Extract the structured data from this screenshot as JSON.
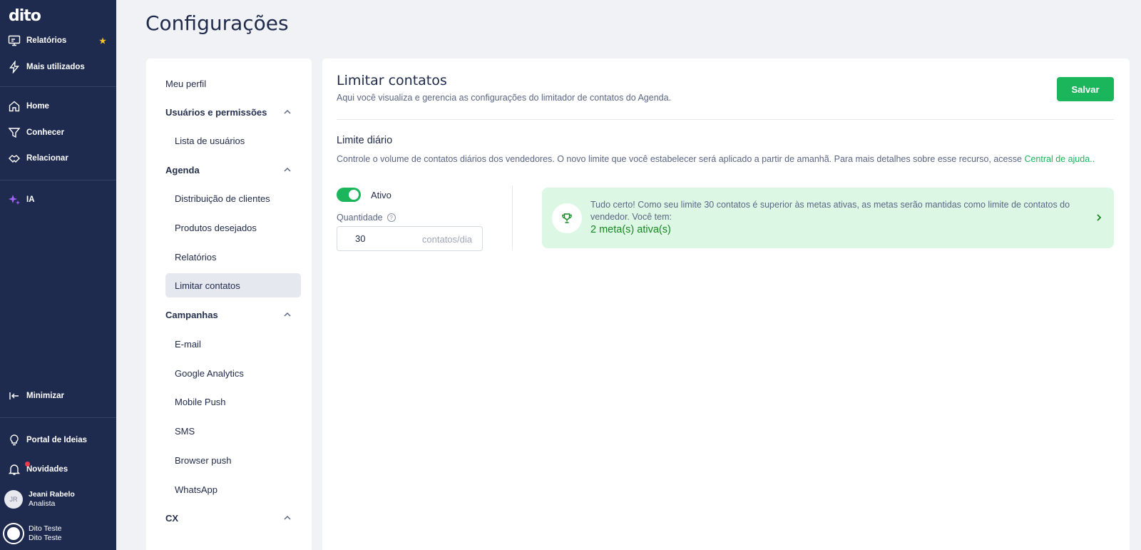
{
  "nav": {
    "logo": "dito",
    "items": [
      {
        "label": "Relatórios"
      },
      {
        "label": "Mais utilizados"
      },
      {
        "label": "Home"
      },
      {
        "label": "Conhecer"
      },
      {
        "label": "Relacionar"
      },
      {
        "label": "IA"
      },
      {
        "label": "Minimizar"
      },
      {
        "label": "Portal de Ideias"
      },
      {
        "label": "Novidades"
      }
    ],
    "user": {
      "initials": "JR",
      "name": "Jeani Rabelo",
      "role": "Analista"
    },
    "account": {
      "name": "Dito Teste",
      "sub": "Dito Teste"
    }
  },
  "page": {
    "title": "Configurações"
  },
  "menu": {
    "items": [
      {
        "label": "Meu perfil"
      },
      {
        "label": "Usuários e permissões"
      },
      {
        "label": "Lista de usuários"
      },
      {
        "label": "Agenda"
      },
      {
        "label": "Distribuição de clientes"
      },
      {
        "label": "Produtos desejados"
      },
      {
        "label": "Relatórios"
      },
      {
        "label": "Limitar contatos"
      },
      {
        "label": "Campanhas"
      },
      {
        "label": "E-mail"
      },
      {
        "label": "Google Analytics"
      },
      {
        "label": "Mobile Push"
      },
      {
        "label": "SMS"
      },
      {
        "label": "Browser push"
      },
      {
        "label": "WhatsApp"
      },
      {
        "label": "CX"
      }
    ]
  },
  "content": {
    "title": "Limitar contatos",
    "subtitle": "Aqui você visualiza e gerencia as configurações do limitador de contatos do Agenda.",
    "save_label": "Salvar",
    "section_title": "Limite diário",
    "description": "Controle o volume de contatos diários dos vendedores. O novo limite que você estabelecer será aplicado a partir de amanhã. Para mais detalhes sobre esse recurso, acesse ",
    "help_link": "Central de ajuda..",
    "toggle_label": "Ativo",
    "quantity_label": "Quantidade",
    "quantity_value": "30",
    "quantity_unit": "contatos/dia",
    "info_text": "Tudo certo! Como seu limite 30 contatos é superior às metas ativas, as metas serão mantidas como limite de contatos do vendedor. Você tem:",
    "info_goals": "2 meta(s) ativa(s)"
  },
  "colors": {
    "nav_bg": "#1e2b4f",
    "accent": "#1bb55c",
    "info_bg": "#dcf8e5"
  }
}
